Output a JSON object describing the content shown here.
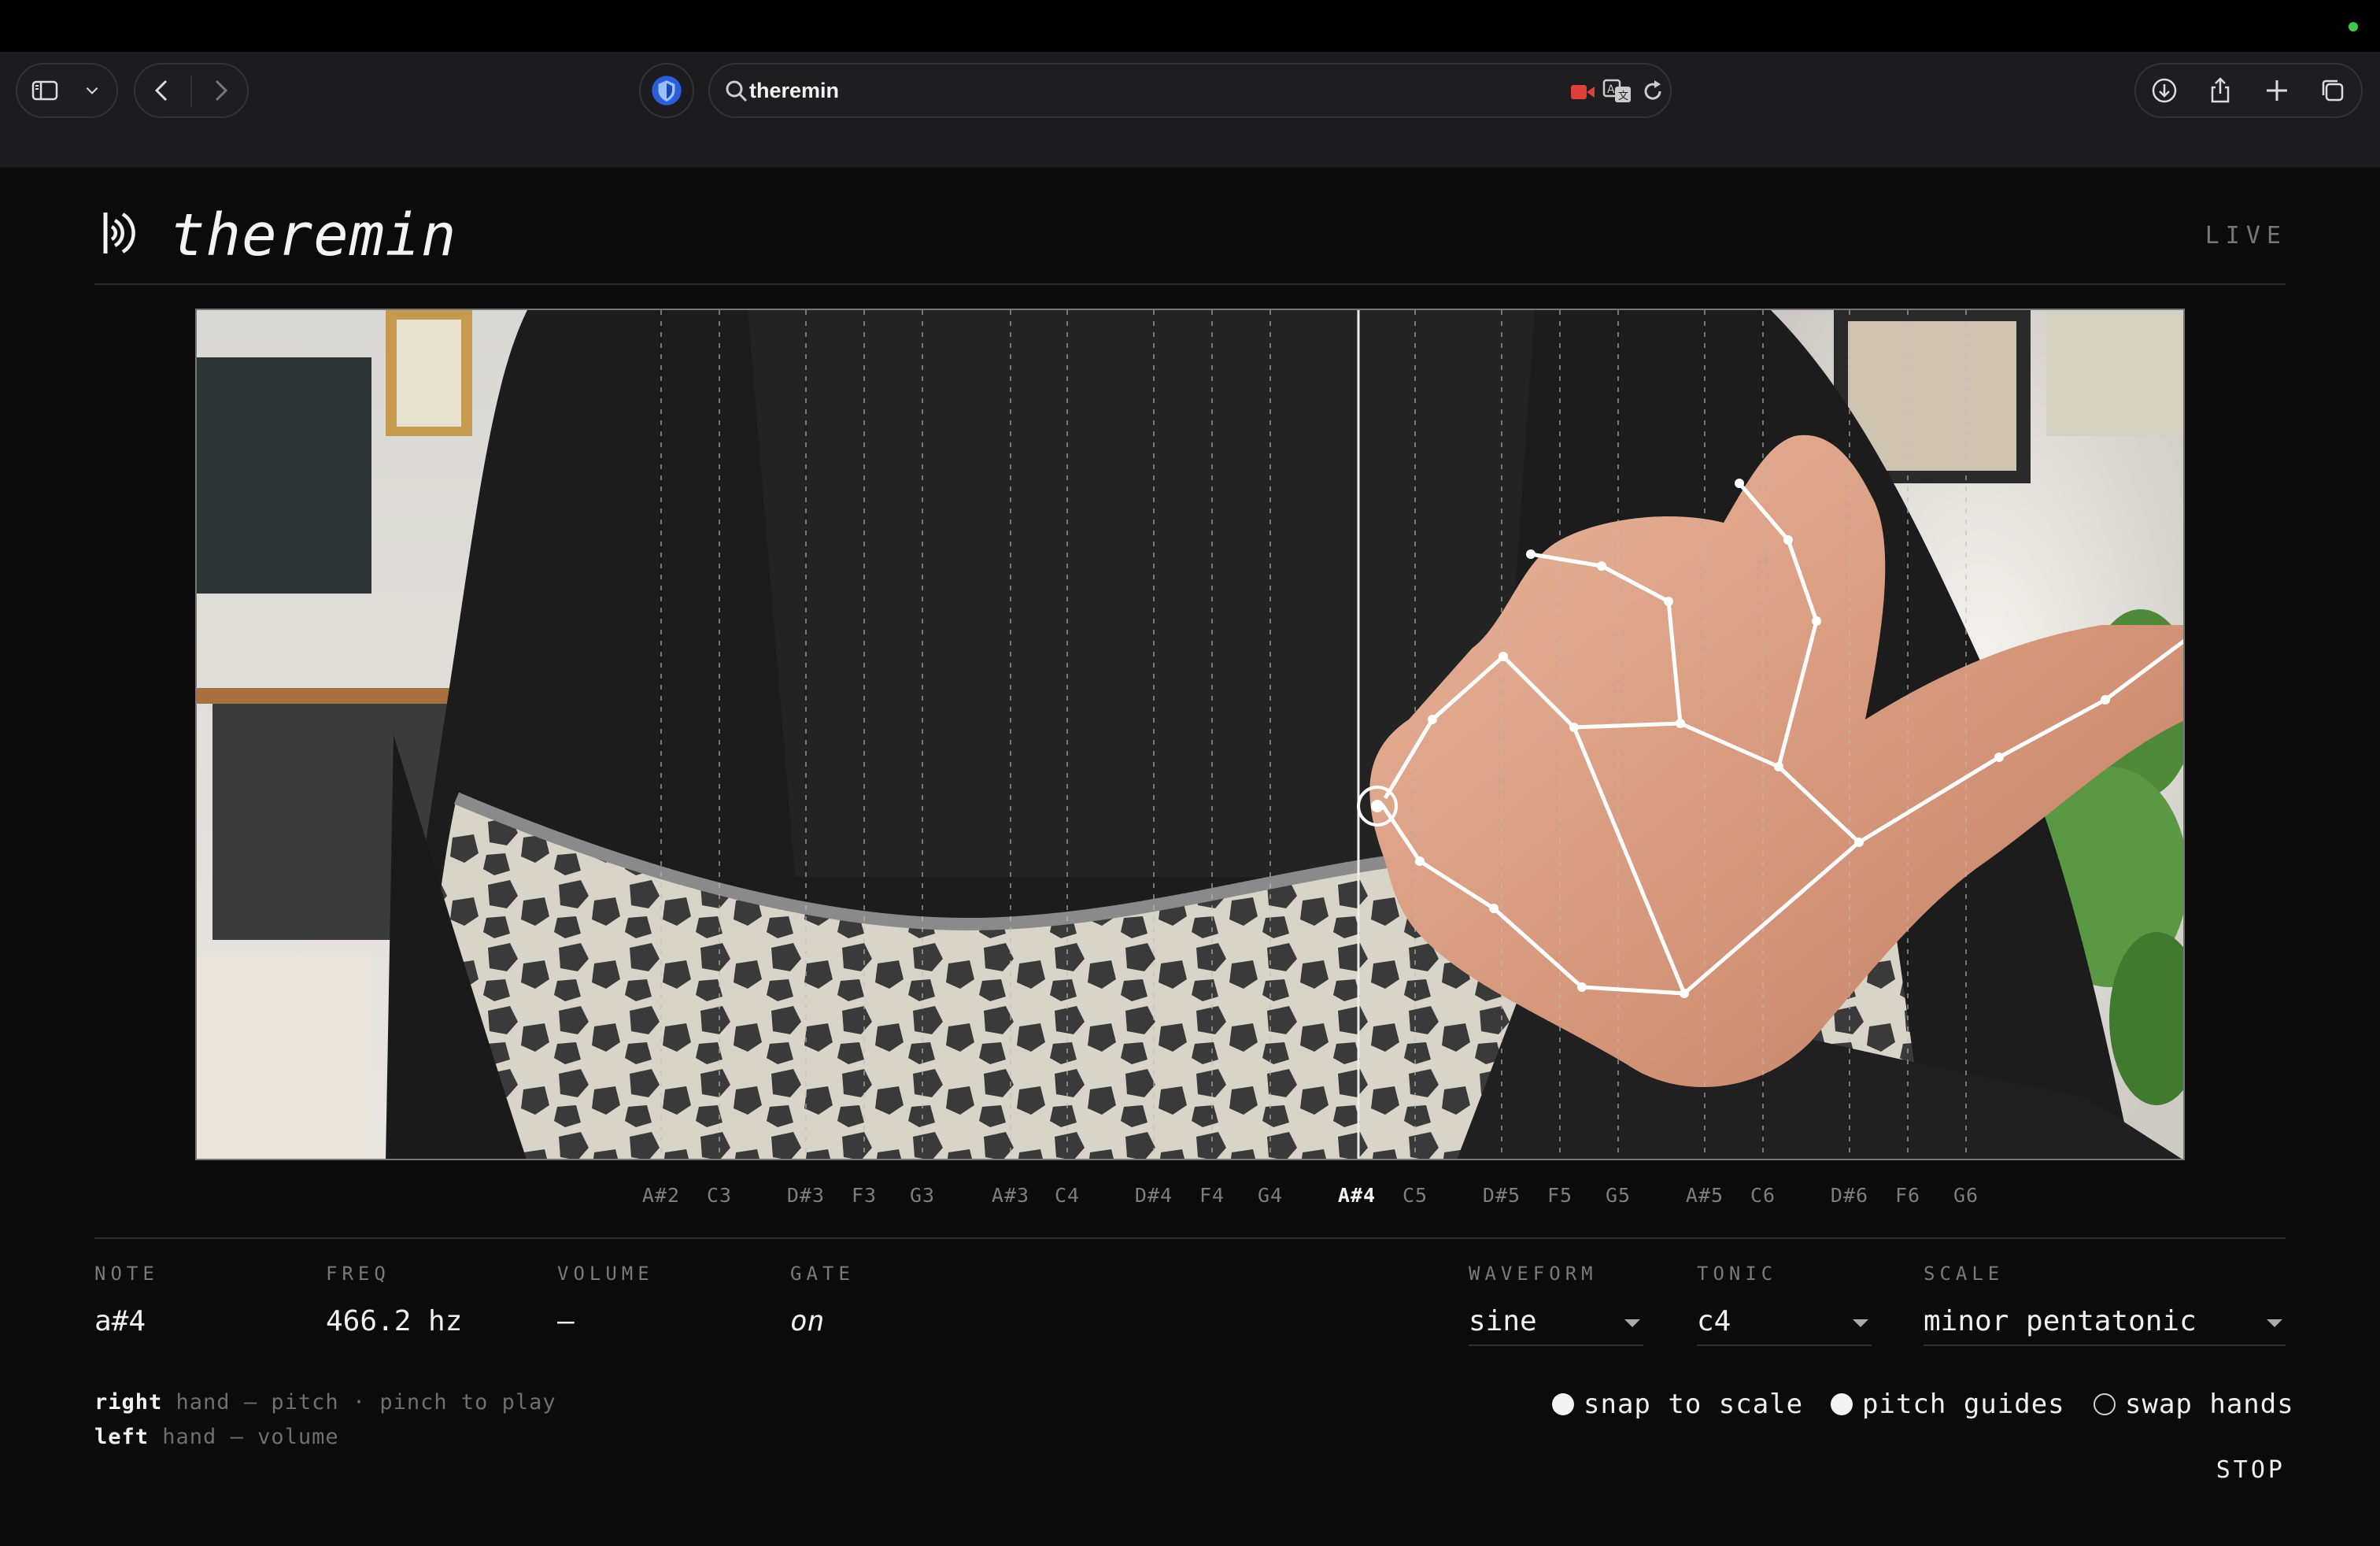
{
  "browser": {
    "url_text": "theremin",
    "icons": [
      "sidebar-icon",
      "chevron-down-icon",
      "back-icon",
      "forward-icon",
      "shield-icon",
      "search-icon",
      "camera-recording-icon",
      "translate-icon",
      "reload-icon",
      "download-icon",
      "share-icon",
      "new-tab-icon",
      "tabs-overview-icon",
      "grid-icon"
    ]
  },
  "app": {
    "title": "theremin",
    "status": "LIVE"
  },
  "pitch_guides": [
    "A#2",
    "C3",
    "D#3",
    "F3",
    "G3",
    "A#3",
    "C4",
    "D#4",
    "F4",
    "G4",
    "A#4",
    "C5",
    "D#5",
    "F5",
    "G5",
    "A#5",
    "C6",
    "D#6",
    "F6",
    "G6"
  ],
  "active_pitch": "A#4",
  "stats": {
    "note_label": "NOTE",
    "note_value": "a#4",
    "freq_label": "FREQ",
    "freq_value": "466.2 hz",
    "volume_label": "VOLUME",
    "volume_value": "—",
    "gate_label": "GATE",
    "gate_value": "on"
  },
  "controls": {
    "waveform_label": "WAVEFORM",
    "waveform_value": "sine",
    "tonic_label": "TONIC",
    "tonic_value": "c4",
    "scale_label": "SCALE",
    "scale_value": "minor pentatonic"
  },
  "hints": {
    "right_key": "right",
    "right_text": " hand — pitch · pinch to play",
    "left_key": "left",
    "left_text": " hand — volume"
  },
  "toggles": {
    "snap_label": "snap to scale",
    "snap_on": true,
    "guides_label": "pitch guides",
    "guides_on": true,
    "swap_label": "swap hands",
    "swap_on": false
  },
  "stop_label": "STOP",
  "colors": {
    "background": "#0b0b0b",
    "text": "#f0f0f0",
    "muted": "#7a7a7a",
    "recording": "#e0403a",
    "shield": "#3a7bff"
  }
}
